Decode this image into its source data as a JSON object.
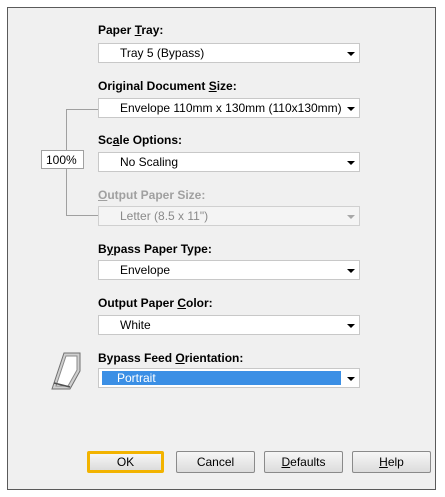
{
  "fields": {
    "paper_tray": {
      "label_pre": "Paper ",
      "label_mnem": "T",
      "label_post": "ray:",
      "value": "Tray 5 (Bypass)"
    },
    "original_size": {
      "label_pre": "Original Document ",
      "label_mnem": "S",
      "label_post": "ize:",
      "value": "Envelope 110mm x 130mm (110x130mm)"
    },
    "scale": {
      "label_pre": "Sc",
      "label_mnem": "a",
      "label_post": "le Options:",
      "value": "No Scaling",
      "percent": "100%"
    },
    "output_size": {
      "label_pre": "",
      "label_mnem": "O",
      "label_post": "utput Paper Size:",
      "value": "Letter (8.5 x 11\")",
      "enabled": false
    },
    "bypass_type": {
      "label_pre": "B",
      "label_mnem": "y",
      "label_post": "pass Paper Type:",
      "value": "Envelope"
    },
    "output_color": {
      "label_pre": "Output Paper ",
      "label_mnem": "C",
      "label_post": "olor:",
      "value": "White"
    },
    "feed_orientation": {
      "label_pre": "Bypass Feed ",
      "label_mnem": "O",
      "label_post": "rientation:",
      "value": "Portrait"
    }
  },
  "buttons": {
    "ok": "OK",
    "cancel": "Cancel",
    "defaults_mnem": "D",
    "defaults_rest": "efaults",
    "help_mnem": "H",
    "help_rest": "elp"
  },
  "icons": {
    "orientation": "portrait-paper-icon"
  },
  "colors": {
    "selection": "#3b8fe5",
    "default_button_border": "#f2b300"
  }
}
